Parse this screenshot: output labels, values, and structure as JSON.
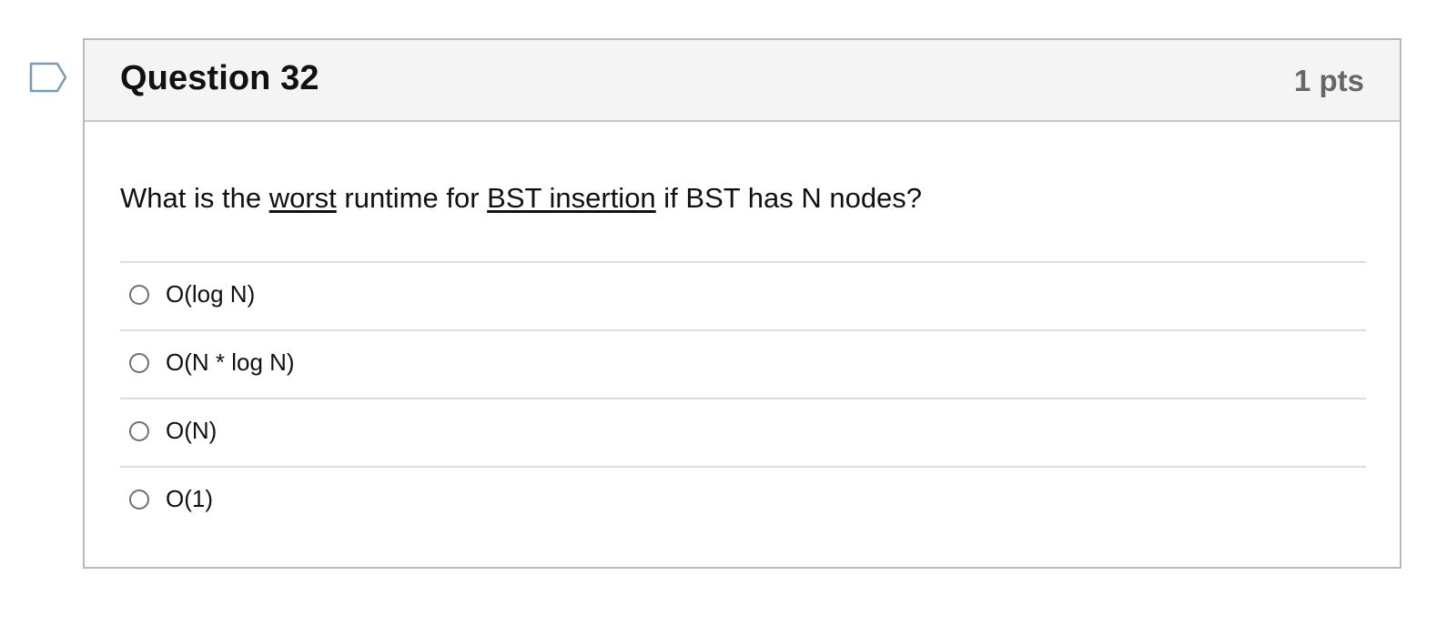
{
  "question": {
    "title": "Question 32",
    "points": "1 pts",
    "prompt_parts": {
      "p1": "What is the ",
      "u1": "worst",
      "p2": " runtime for ",
      "u2": "BST insertion",
      "p3": " if BST has N nodes?"
    },
    "answers": [
      {
        "label": "O(log N)"
      },
      {
        "label": "O(N * log N)"
      },
      {
        "label": "O(N)"
      },
      {
        "label": "O(1)"
      }
    ],
    "flag_icon": "bookmark-flag-icon"
  },
  "colors": {
    "header_bg": "#f4f4f4",
    "border": "#b9b9b9",
    "points_text": "#676767",
    "flag_stroke": "#7a9bb7"
  }
}
